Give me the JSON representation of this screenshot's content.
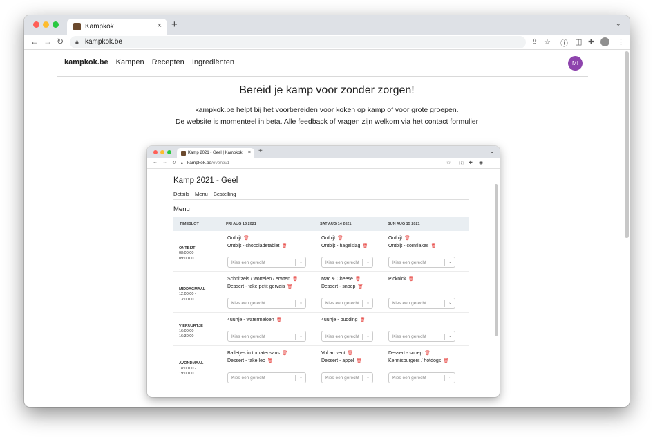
{
  "browser": {
    "tab_title": "Kampkok",
    "new_tab": "+",
    "close": "×",
    "url": "kampkok.be",
    "colors": {
      "close_dot": "#ff5f57",
      "min_dot": "#febc2e",
      "max_dot": "#28c840"
    }
  },
  "site": {
    "brand": "kampkok.be",
    "nav": [
      "Kampen",
      "Recepten",
      "Ingrediënten"
    ],
    "user_initials": "MI",
    "hero_title": "Bereid je kamp voor zonder zorgen!",
    "hero_line1": "kampkok.be helpt bij het voorbereiden voor koken op kamp of voor grote groepen.",
    "hero_line2_prefix": "De website is momenteel in beta. Alle feedback of vragen zijn welkom via het",
    "hero_link": "contact formulier"
  },
  "inner": {
    "tab_title": "Kamp 2021 - Geel | Kampkok",
    "url_host": "kampkok.be",
    "url_path": "/events/1",
    "page_title": "Kamp 2021 - Geel",
    "subnav": [
      "Details",
      "Menu",
      "Bestelling"
    ],
    "section_heading": "Menu",
    "columns": [
      "TIMESLOT",
      "FRI AUG 13 2021",
      "SAT AUG 14 2021",
      "SUN AUG 15 2021"
    ],
    "select_placeholder": "Kies een gerecht",
    "rows": [
      {
        "name": "ONTBIJT",
        "time1": "08:00:00 -",
        "time2": "09:00:00",
        "cells": [
          [
            "Ontbijt",
            "Ontbijt - chocoladetablet"
          ],
          [
            "Ontbijt",
            "Ontbijt - hagelslag"
          ],
          [
            "Ontbijt",
            "Ontbijt - cornflakes"
          ]
        ]
      },
      {
        "name": "MIDDAGMAAL",
        "time1": "12:00:00 -",
        "time2": "13:00:00",
        "cells": [
          [
            "Schnitzels / wortelen / erwten",
            "Dessert - fake petit gervais"
          ],
          [
            "Mac & Cheese",
            "Dessert - snoep"
          ],
          [
            "Picknick"
          ]
        ]
      },
      {
        "name": "VIERUURTJE",
        "time1": "16:00:00 -",
        "time2": "16:30:00",
        "cells": [
          [
            "4uurtje - watermeloen"
          ],
          [
            "4uurtje - pudding"
          ],
          []
        ]
      },
      {
        "name": "AVONDMAAL",
        "time1": "18:00:00 -",
        "time2": "19:00:00",
        "cells": [
          [
            "Balletjes in tomatensaus",
            "Dessert - fake leo"
          ],
          [
            "Vol au vent",
            "Dessert - appel"
          ],
          [
            "Dessert - snoep",
            "Kermisburgers / hotdogs"
          ]
        ]
      }
    ]
  }
}
